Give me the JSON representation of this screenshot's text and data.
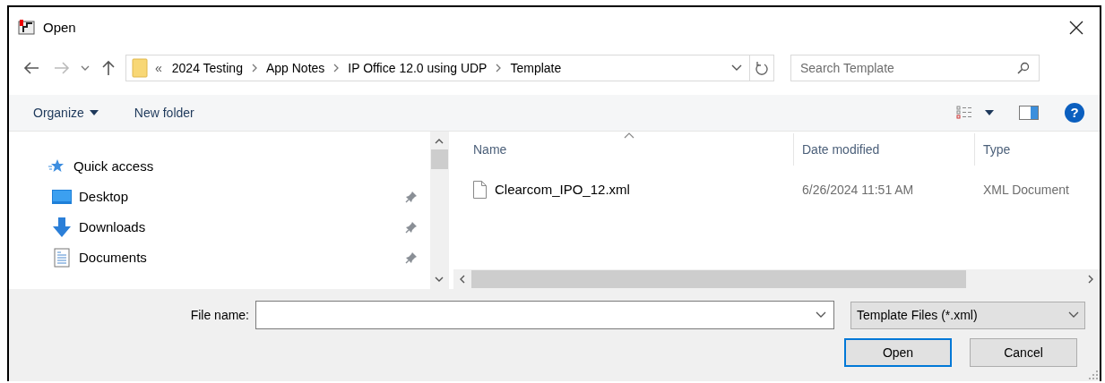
{
  "window": {
    "title": "Open"
  },
  "address": {
    "overflow": "«",
    "path": [
      "2024 Testing",
      "App Notes",
      "IP Office 12.0 using UDP",
      "Template"
    ]
  },
  "search": {
    "placeholder": "Search Template"
  },
  "toolbar": {
    "organize": "Organize",
    "new_folder": "New folder",
    "help": "?"
  },
  "nav": [
    {
      "label": "Quick access",
      "kind": "quick",
      "pinned": false
    },
    {
      "label": "Desktop",
      "kind": "desktop",
      "pinned": true
    },
    {
      "label": "Downloads",
      "kind": "downloads",
      "pinned": true
    },
    {
      "label": "Documents",
      "kind": "documents",
      "pinned": true
    }
  ],
  "table": {
    "columns": [
      "Name",
      "Date modified",
      "Type"
    ],
    "rows": [
      {
        "name": "Clearcom_IPO_12.xml",
        "date": "6/26/2024 11:51 AM",
        "type": "XML Document",
        "selected": false
      }
    ]
  },
  "file_name": {
    "label": "File name:"
  },
  "file_type": {
    "value": "Template Files (*.xml)"
  },
  "buttons": [
    {
      "label": "Open",
      "default": true
    },
    {
      "label": "Cancel",
      "default": false
    }
  ]
}
